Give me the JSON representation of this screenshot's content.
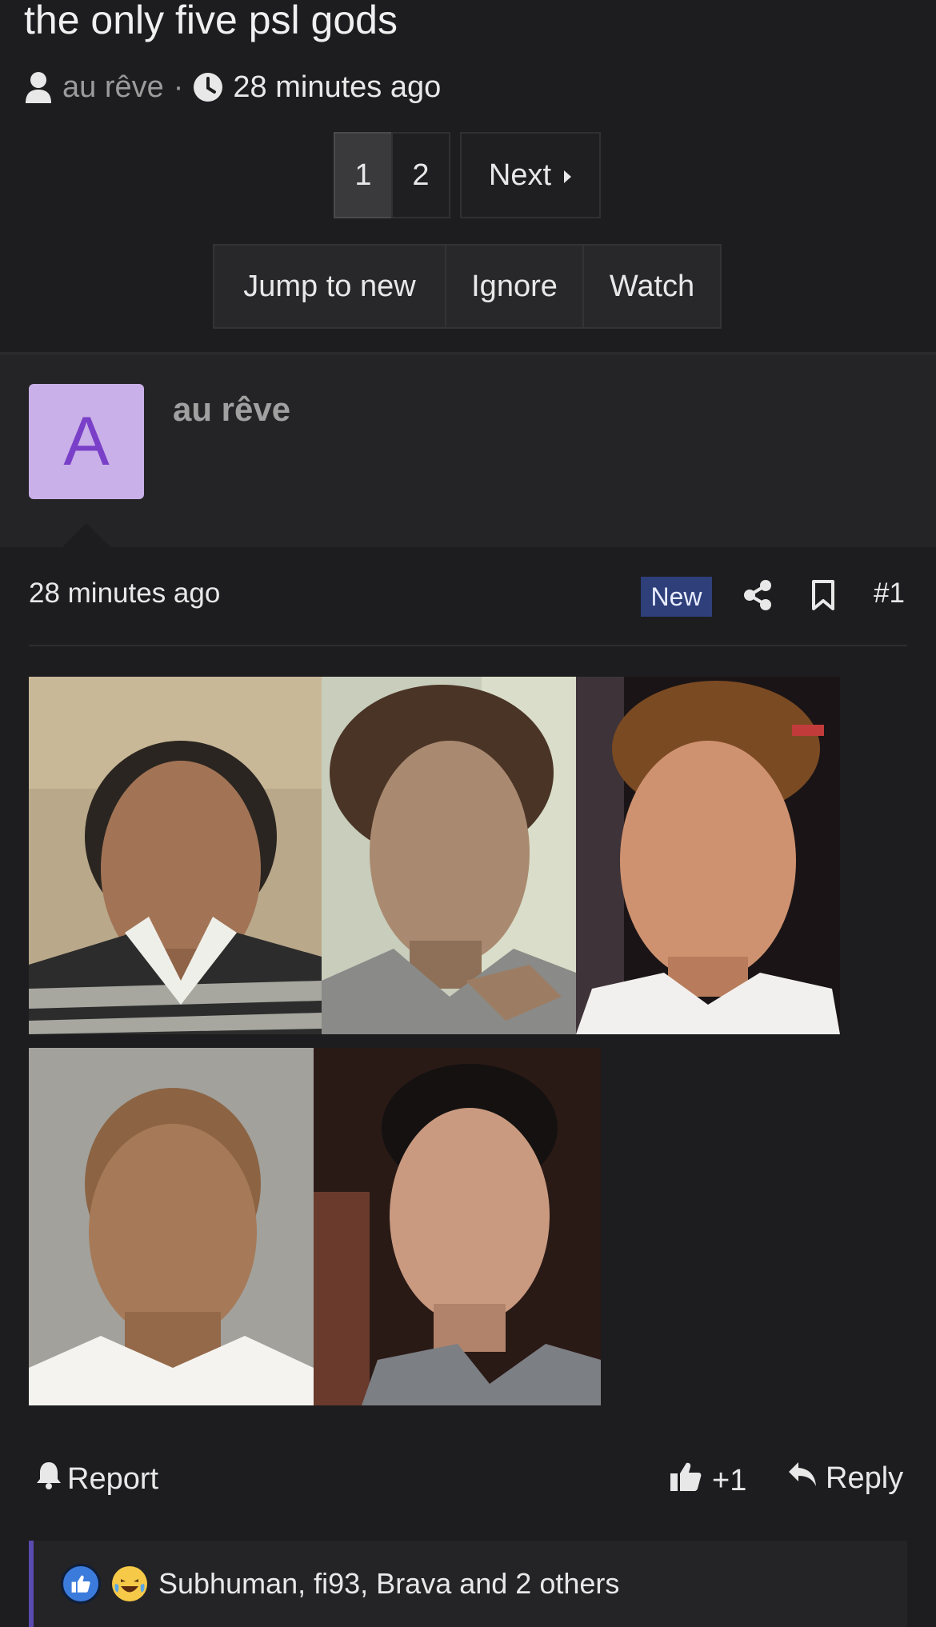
{
  "thread": {
    "title": "the only five psl gods",
    "author": "au rêve",
    "separator": "·",
    "time": "28 minutes ago"
  },
  "pagination": {
    "pages": [
      "1",
      "2"
    ],
    "current": "1",
    "next_label": "Next"
  },
  "thread_actions": {
    "jump_to_new": "Jump to new",
    "ignore": "Ignore",
    "watch": "Watch"
  },
  "post": {
    "avatar_letter": "A",
    "avatar_color": "#c9b0e8",
    "poster_name": "au rêve",
    "time": "28 minutes ago",
    "badge": "New",
    "number": "#1",
    "images": [
      "photo-1",
      "photo-2",
      "photo-3",
      "photo-4",
      "photo-5"
    ]
  },
  "post_actions": {
    "report": "Report",
    "like_count": "+1",
    "reply": "Reply"
  },
  "reactions": {
    "icons": [
      "like-reaction-icon",
      "laugh-reaction-icon"
    ],
    "text": "Subhuman, fi93, Brava and 2 others"
  },
  "colors": {
    "background": "#1d1d1f",
    "badge": "#2e3f7a",
    "reaction_bar_accent": "#5a4bb0"
  }
}
